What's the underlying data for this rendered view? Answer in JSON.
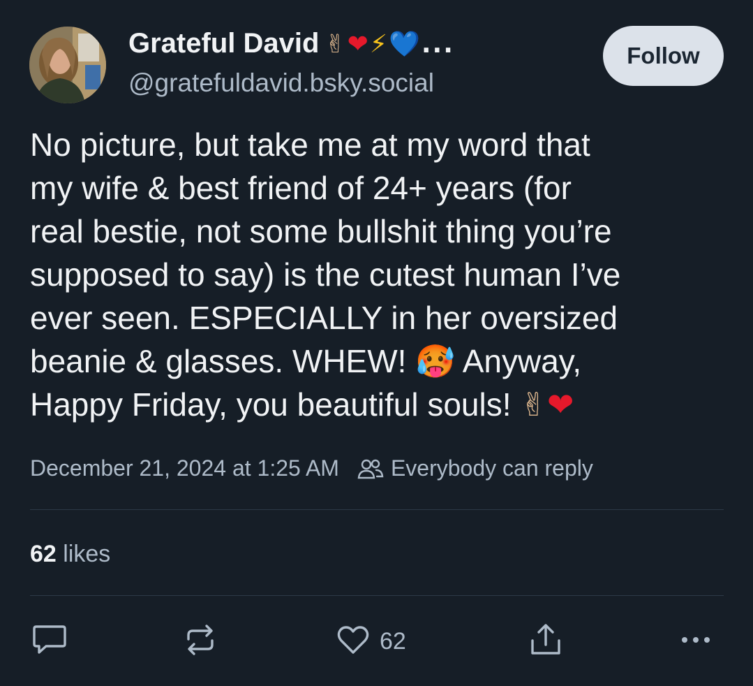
{
  "author": {
    "display_name": "Grateful David",
    "name_emojis": {
      "peace": "✌",
      "heart": "❤",
      "bolt": "⚡",
      "blue_heart": "💙",
      "ellipsis": "..."
    },
    "handle": "@gratefuldavid.bsky.social",
    "avatar_icon": "avatar-photo"
  },
  "follow_label": "Follow",
  "post": {
    "lines": [
      "No picture, but take me at my word that",
      "my wife & best friend of 24+ years (for",
      "real bestie, not some bullshit thing you’re",
      "supposed to say) is the cutest human I’ve",
      "ever seen. ESPECIALLY in her oversized",
      "beanie & glasses. WHEW!",
      "Anyway,",
      "Happy Friday, you beautiful souls!"
    ],
    "hot_face_emoji": "🥵",
    "peace_emoji": "✌",
    "heart_emoji": "❤"
  },
  "meta": {
    "timestamp": "December 21, 2024 at 1:25 AM",
    "reply_setting": "Everybody can reply",
    "reply_icon": "people-icon"
  },
  "likes": {
    "count": "62",
    "label": "likes"
  },
  "actions": {
    "reply_icon": "comment-icon",
    "repost_icon": "repost-icon",
    "like_icon": "heart-icon",
    "like_count": "62",
    "share_icon": "share-icon",
    "more_icon": "more-icon"
  },
  "colors": {
    "background": "#161e27",
    "text": "#f1f3f5",
    "muted": "#aebbc9",
    "follow_bg": "#dce2ea",
    "divider": "#2c3947"
  }
}
